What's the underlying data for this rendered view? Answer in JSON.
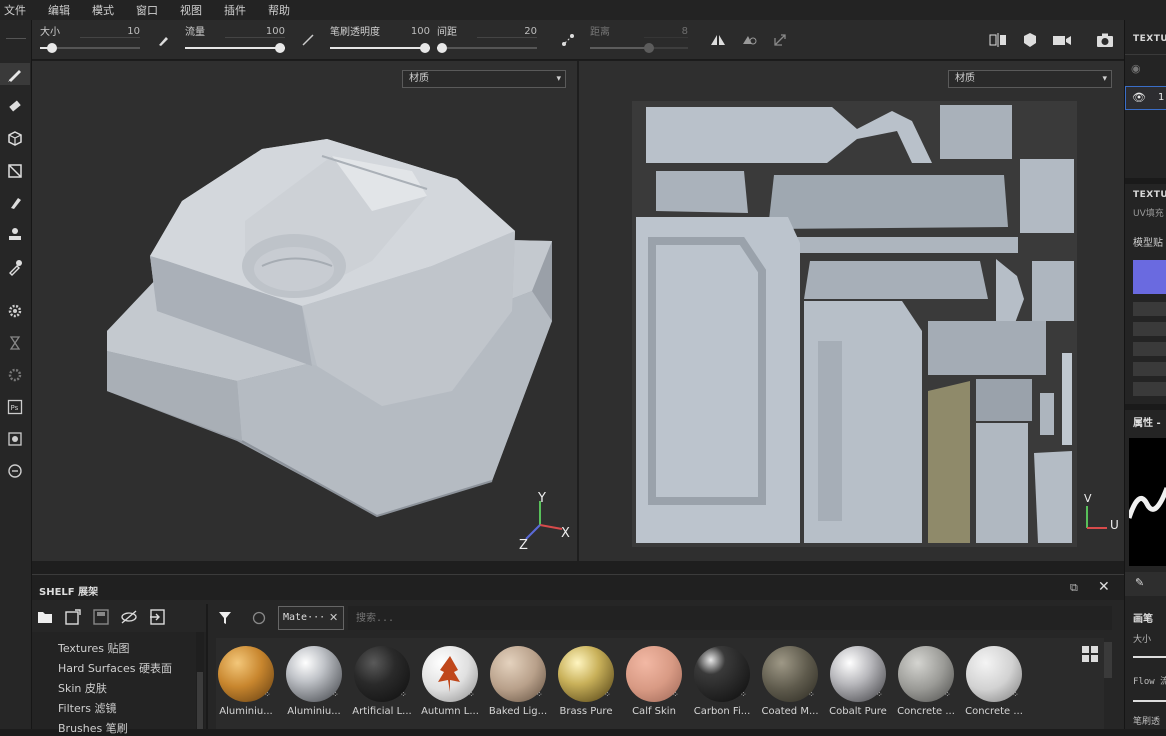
{
  "menu": [
    "文件",
    "编辑",
    "模式",
    "窗口",
    "视图",
    "插件",
    "帮助"
  ],
  "toolbar": {
    "size": {
      "label": "大小",
      "value": "10"
    },
    "flow": {
      "label": "流量",
      "value": "100"
    },
    "opacity": {
      "label": "笔刷透明度",
      "value": "100"
    },
    "spacing": {
      "label": "间距",
      "value": "20"
    },
    "distance": {
      "label": "距离",
      "value": "8"
    }
  },
  "levels": {
    "size": 0.12,
    "flow": 1.0,
    "opacity": 1.0,
    "spacing": 0.04,
    "distance": 0.6
  },
  "viewport3d": {
    "dropdown": "材质",
    "axis": {
      "y": "Y",
      "x": "X",
      "z": "Z"
    }
  },
  "viewport2d": {
    "dropdown": "材质",
    "axis": {
      "v": "V",
      "u": "U"
    }
  },
  "right_panel": {
    "texture_set_list_title": "TEXTUR",
    "layer_row": "1",
    "texture_set_settings_title": "TEXTUR",
    "uv_label": "UV填充",
    "model_maps_label": "模型贴",
    "properties_title": "属性 -",
    "brush_label": "画笔",
    "size_label": "大小",
    "flow_label": "Flow 流",
    "opacity_label": "笔刷透"
  },
  "shelf": {
    "title": "SHELF 展架",
    "filter_chip": "Mate···",
    "search_placeholder": "搜索...",
    "categories": [
      "Textures 贴图",
      "Hard Surfaces 硬表面",
      "Skin 皮肤",
      "Filters 滤镜",
      "Brushes 笔刷"
    ],
    "materials": [
      {
        "name": "Aluminiu...",
        "color": "#c8862e"
      },
      {
        "name": "Aluminiu...",
        "color": "#bfc2c6"
      },
      {
        "name": "Artificial L...",
        "color": "#2a2a2a"
      },
      {
        "name": "Autumn L...",
        "color": "#e8e8e8"
      },
      {
        "name": "Baked Lig...",
        "color": "#c2ab94"
      },
      {
        "name": "Brass Pure",
        "color": "#c9b15a"
      },
      {
        "name": "Calf Skin",
        "color": "#d89a84"
      },
      {
        "name": "Carbon Fi...",
        "color": "#1b1b1b"
      },
      {
        "name": "Coated M...",
        "color": "#5e5a4c"
      },
      {
        "name": "Cobalt Pure",
        "color": "#b8b8bc"
      },
      {
        "name": "Concrete ...",
        "color": "#9a9a96"
      },
      {
        "name": "Concrete ...",
        "color": "#d2d2d2"
      }
    ]
  }
}
